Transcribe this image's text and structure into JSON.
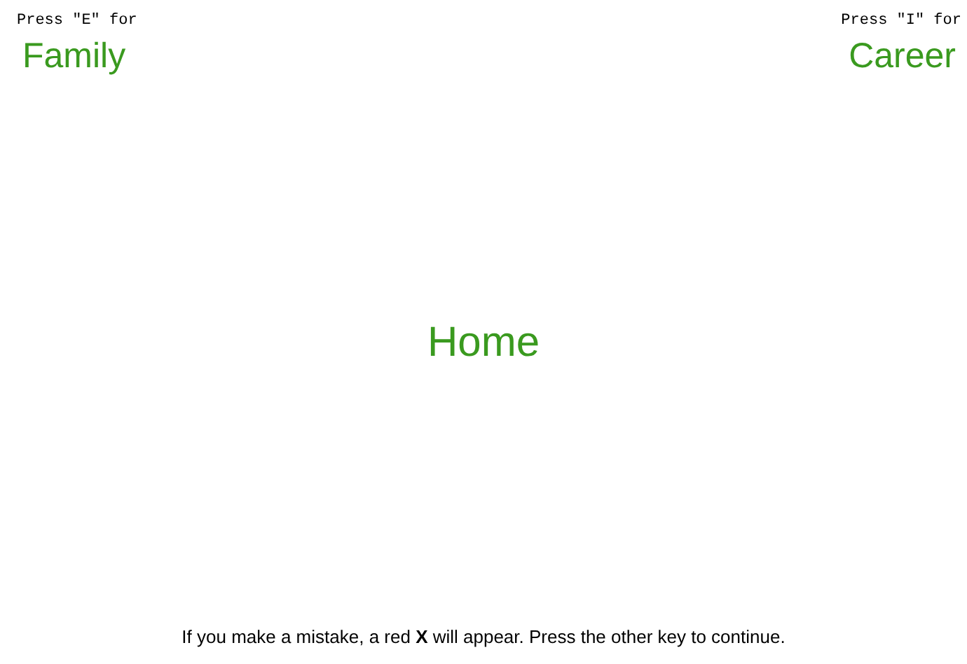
{
  "left": {
    "prompt": "Press \"E\" for",
    "category": "Family"
  },
  "right": {
    "prompt": "Press \"I\" for",
    "category": "Career"
  },
  "stimulus": "Home",
  "instruction": "If you make a mistake, a red **X** will appear. Press the other key to continue."
}
